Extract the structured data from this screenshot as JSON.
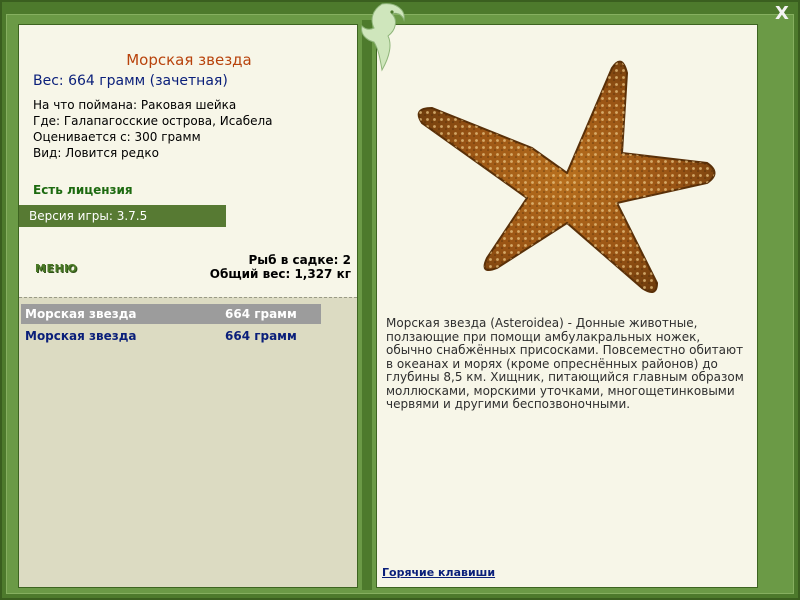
{
  "fish": {
    "title": "Морская звезда",
    "weight_line": "Вес: 664 грамм (зачетная)",
    "info": [
      "На что поймана: Раковая шейка",
      "Где: Галапагосские острова, Исабела",
      "Оценивается с: 300 грамм",
      "Вид: Ловится редко"
    ],
    "license": "Есть лицензия",
    "description": "Морская звезда (Asteroidea) - Донные животные, ползающие при помощи амбулакральных ножек, обычно снабжённых присосками. Повсеместно обитают в океанах и морях (кроме опреснённых районов) до глубины 8,5 км. Хищник, питающийся главным образом моллюсками, морскими уточками, многощетинковыми червями и другими беспозвоночными."
  },
  "version": "Версия игры: 3.7.5",
  "menu_label": "МЕНЮ",
  "stats": {
    "in_cage": "Рыб в садке: 2",
    "total_weight": "Общий вес: 1,327 кг"
  },
  "catches": [
    {
      "name": "Морская звезда",
      "weight": "664 грамм",
      "selected": true
    },
    {
      "name": "Морская звезда",
      "weight": "664 грамм",
      "selected": false
    }
  ],
  "hotkeys": "Горячие клавиши",
  "close_label": "X",
  "icons": {
    "close": "close-icon",
    "logo": "dolphin-logo-icon",
    "fish_image": "starfish-image"
  },
  "colors": {
    "frame": "#4d7a2c",
    "panel": "#f7f6e8",
    "title": "#b8430c",
    "accent_blue": "#0a1f7a",
    "license_green": "#1d6a10",
    "version_bar": "#577a33"
  }
}
